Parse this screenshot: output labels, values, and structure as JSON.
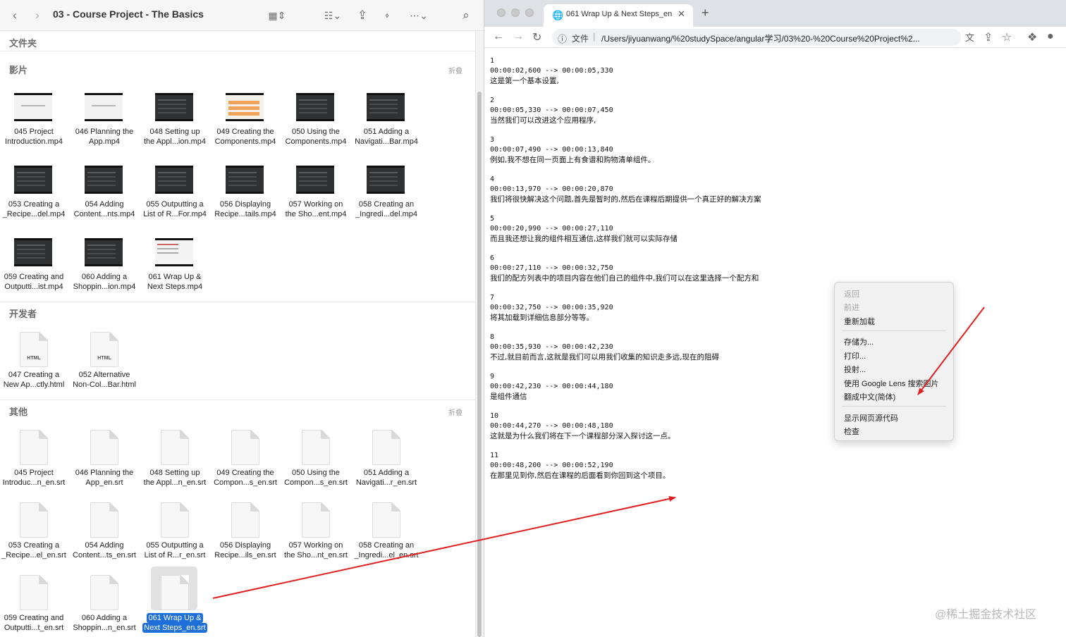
{
  "finder": {
    "title": "03 - Course Project - The Basics",
    "folders_label": "文件夹",
    "collapse_label": "折叠",
    "sections": {
      "movies": {
        "label": "影片",
        "items": [
          {
            "line1": "045 Project",
            "line2": "Introduction.mp4",
            "thumb": "light"
          },
          {
            "line1": "046 Planning the",
            "line2": "App.mp4",
            "thumb": "light"
          },
          {
            "line1": "048 Setting up",
            "line2": "the Appl...ion.mp4",
            "thumb": "dark"
          },
          {
            "line1": "049 Creating the",
            "line2": "Components.mp4",
            "thumb": "orange"
          },
          {
            "line1": "050 Using the",
            "line2": "Components.mp4",
            "thumb": "dark"
          },
          {
            "line1": "051 Adding a",
            "line2": "Navigati...Bar.mp4",
            "thumb": "dark"
          },
          {
            "line1": "053 Creating a",
            "line2": "_Recipe...del.mp4",
            "thumb": "dark"
          },
          {
            "line1": "054 Adding",
            "line2": "Content...nts.mp4",
            "thumb": "dark"
          },
          {
            "line1": "055 Outputting a",
            "line2": "List of R...For.mp4",
            "thumb": "dark"
          },
          {
            "line1": "056 Displaying",
            "line2": "Recipe...tails.mp4",
            "thumb": "dark"
          },
          {
            "line1": "057 Working on",
            "line2": "the Sho...ent.mp4",
            "thumb": "dark"
          },
          {
            "line1": "058 Creating an",
            "line2": "_Ingredi...del.mp4",
            "thumb": "dark"
          },
          {
            "line1": "059 Creating and",
            "line2": "Outputti...ist.mp4",
            "thumb": "dark"
          },
          {
            "line1": "060 Adding a",
            "line2": "Shoppin...ion.mp4",
            "thumb": "dark"
          },
          {
            "line1": "061 Wrap Up &",
            "line2": "Next Steps.mp4",
            "thumb": "shot"
          }
        ]
      },
      "developer": {
        "label": "开发者",
        "items": [
          {
            "line1": "047 Creating a",
            "line2": "New Ap...ctly.html",
            "tag": "HTML"
          },
          {
            "line1": "052 Alternative",
            "line2": "Non-Col...Bar.html",
            "tag": "HTML"
          }
        ]
      },
      "other": {
        "label": "其他",
        "items": [
          {
            "line1": "045 Project",
            "line2": "Introduc...n_en.srt"
          },
          {
            "line1": "046 Planning the",
            "line2": "App_en.srt"
          },
          {
            "line1": "048 Setting up",
            "line2": "the Appl...n_en.srt"
          },
          {
            "line1": "049 Creating the",
            "line2": "Compon...s_en.srt"
          },
          {
            "line1": "050 Using the",
            "line2": "Compon...s_en.srt"
          },
          {
            "line1": "051 Adding a",
            "line2": "Navigati...r_en.srt"
          },
          {
            "line1": "053 Creating a",
            "line2": "_Recipe...el_en.srt"
          },
          {
            "line1": "054 Adding",
            "line2": "Content...ts_en.srt"
          },
          {
            "line1": "055 Outputting a",
            "line2": "List of R...r_en.srt"
          },
          {
            "line1": "056 Displaying",
            "line2": "Recipe...ils_en.srt"
          },
          {
            "line1": "057 Working on",
            "line2": "the Sho...nt_en.srt"
          },
          {
            "line1": "058 Creating an",
            "line2": "_Ingredi...el_en.srt"
          },
          {
            "line1": "059 Creating and",
            "line2": "Outputti...t_en.srt"
          },
          {
            "line1": "060 Adding a",
            "line2": "Shoppin...n_en.srt"
          },
          {
            "line1": "061 Wrap Up &",
            "line2": "Next Steps_en.srt",
            "selected": true
          }
        ]
      }
    },
    "toolbar_icons": [
      "chevron-left-icon",
      "chevron-right-icon",
      "grid-view-icon",
      "group-icon",
      "share-icon",
      "tag-icon",
      "more-icon",
      "search-icon"
    ]
  },
  "browser": {
    "tab_title": "061 Wrap Up & Next Steps_en",
    "url_scheme": "文件",
    "url": "/Users/jiyuanwang/%20studySpace/angular学习/03%20-%20Course%20Project%2..."
  },
  "subtitles": [
    {
      "index": "1",
      "time": "00:00:02,600 --> 00:00:05,330",
      "text": "这是第一个基本设置,"
    },
    {
      "index": "2",
      "time": "00:00:05,330 --> 00:00:07,450",
      "text": "当然我们可以改进这个应用程序,"
    },
    {
      "index": "3",
      "time": "00:00:07,490 --> 00:00:13,840",
      "text": "例如,我不想在同一页面上有食谱和购物清单组件。"
    },
    {
      "index": "4",
      "time": "00:00:13,970 --> 00:00:20,870",
      "text": "我们将很快解决这个问题,首先是暂时的,然后在课程后期提供一个真正好的解决方案"
    },
    {
      "index": "5",
      "time": "00:00:20,990 --> 00:00:27,110",
      "text": "而且我还想让我的组件相互通信,这样我们就可以实际存储"
    },
    {
      "index": "6",
      "time": "00:00:27,110 --> 00:00:32,750",
      "text": "我们的配方列表中的项目内容在他们自己的组件中,我们可以在这里选择一个配方和"
    },
    {
      "index": "7",
      "time": "00:00:32,750 --> 00:00:35,920",
      "text": "将其加载到详细信息部分等等。"
    },
    {
      "index": "8",
      "time": "00:00:35,930 --> 00:00:42,230",
      "text": "不过,就目前而言,这就是我们可以用我们收集的知识走多远,现在的阻碍"
    },
    {
      "index": "9",
      "time": "00:00:42,230 --> 00:00:44,180",
      "text": "是组件通信"
    },
    {
      "index": "10",
      "time": "00:00:44,270 --> 00:00:48,180",
      "text": "这就是为什么我们将在下一个课程部分深入探讨这一点。"
    },
    {
      "index": "11",
      "time": "00:00:48,200 --> 00:00:52,190",
      "text": "在那里见到你,然后在课程的后面看到你回到这个项目。"
    }
  ],
  "context_menu": {
    "back": "返回",
    "forward": "前进",
    "reload": "重新加载",
    "save_as": "存储为...",
    "print": "打印...",
    "cast": "投射...",
    "google_lens": "使用 Google Lens 搜索图片",
    "translate": "翻成中文(简体)",
    "view_source": "显示网页源代码",
    "inspect": "检查"
  },
  "annotation_color": "#e02020",
  "watermark": "@稀土掘金技术社区"
}
